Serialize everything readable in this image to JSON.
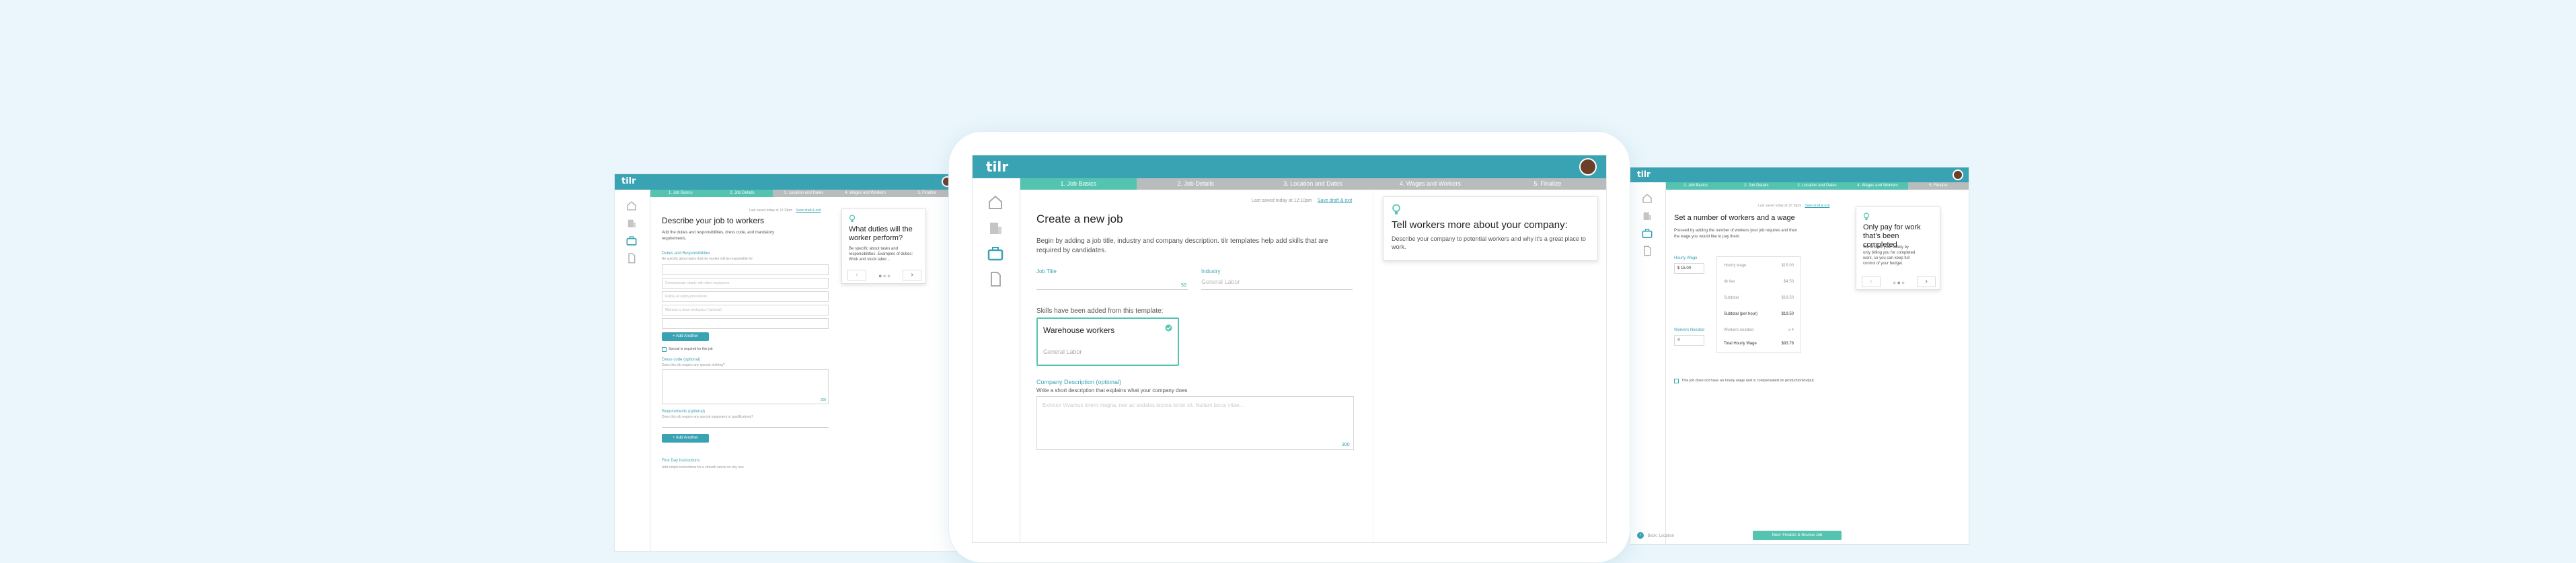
{
  "brand": {
    "logo": "tilr",
    "accent": "#3aa3b3",
    "step_done": "#54c4b0",
    "step_todo": "#b9bcbd",
    "background": "#eaf6fc"
  },
  "nav_icons": [
    "home-icon",
    "building-icon",
    "briefcase-icon",
    "document-icon"
  ],
  "center": {
    "steps": [
      "1. Job Basics",
      "2. Job Details",
      "3. Location and Dates",
      "4. Wages and Workers",
      "5. Finalize"
    ],
    "last_saved": "Last saved today at 12:10pm",
    "save_exit": "Save draft & exit",
    "heading": "Create a new job",
    "intro": "Begin by adding a job title, industry and company description. tilr templates help add skills that are required by candidates.",
    "job_title_label": "Job Title",
    "job_title_count": "50",
    "industry_label": "Industry",
    "industry_placeholder": "General Labor",
    "skills_note": "Skills have been added from this template:",
    "template_name": "Warehouse workers",
    "template_industry": "General Labor",
    "company_desc_label": "Company Description (optional)",
    "company_desc_help": "Write a short description that explains what your company does",
    "company_desc_placeholder": "Ex/xxxx Vivamus lorem magna, nec ac sodales lacinia tortor sit. Nullam lacus vitae...",
    "company_desc_count": "300",
    "tip_title": "Tell workers more about your company:",
    "tip_body": "Describe your company to potential workers and why it's a great place to work."
  },
  "left": {
    "steps": [
      "1. Job Basics",
      "2. Job Details",
      "3. Location and Dates",
      "4. Wages and Workers",
      "5. Finalize"
    ],
    "last_saved": "Last saved today at 12:10pm",
    "save_exit": "Save draft & exit",
    "heading": "Describe your job to workers",
    "intro": "Add the duties and responsibilities, dress code, and mandatory requirements.",
    "duties_label": "Duties and Responsibilities",
    "duties_help": "Be specific about tasks that the worker will be responsible for",
    "duty_placeholders": [
      "",
      "Communicate clearly with other employees",
      "Follow all safety procedures",
      "Maintain a clean workspace (optional)"
    ],
    "add_another": "+ Add Another",
    "special_equipment": "Special is required for this job",
    "dress_code_label": "Dress code (optional)",
    "dress_code_help": "Does this job require any special clothing?",
    "dress_code_count": "300",
    "requirements_label": "Requirements (optional)",
    "requirements_help": "Does this job require any special equipment or qualifications?",
    "add_another_2": "+ Add Another",
    "first_day_label": "First Day Instructions",
    "first_day_help": "Add simple instructions for a smooth arrival on day one",
    "tip_title": "What duties will the worker perform?",
    "tip_body": "Be specific about tasks and responsibilities. Examples of duties: Work and stock labor...",
    "tip_prev": "‹",
    "tip_next": "›"
  },
  "right": {
    "steps": [
      "1. Job Basics",
      "2. Job Details",
      "3. Location and Dates",
      "4. Wages and Workers",
      "5. Finalize"
    ],
    "last_saved": "Last saved today at 12:10pm",
    "save_exit": "Save draft & exit",
    "heading": "Set a number of workers and a wage",
    "intro": "Proceed by adding the number of workers your job requires and then the wage you would like to pay them.",
    "hourly_wage_label": "Hourly Wage",
    "hourly_wage_value": "$ 15.00",
    "workers_label": "Workers Needed",
    "workers_value": "4",
    "summary_rows": [
      {
        "label": "Hourly wage",
        "value": "$15.00"
      },
      {
        "label": "tilr fee",
        "value": "$4.50"
      },
      {
        "label": "Subtotal",
        "value": "$19.50"
      },
      {
        "label": "Subtotal (per hour)",
        "value": "$19.50"
      },
      {
        "label": "Workers needed",
        "value": "x 4"
      },
      {
        "label": "Total Hourly Wage",
        "value": "$93.78"
      }
    ],
    "no_hourly": "This job does not have an hourly wage and is compensated on production/output.",
    "back": "Back: Location",
    "next": "Next: Finalize & Review Job",
    "tip_title": "Only pay for work that's been completed",
    "tip_body": "We ensure your safety by only billing you for completed work, so you can keep full control of your budget.",
    "tip_prev": "‹",
    "tip_next": "›"
  }
}
